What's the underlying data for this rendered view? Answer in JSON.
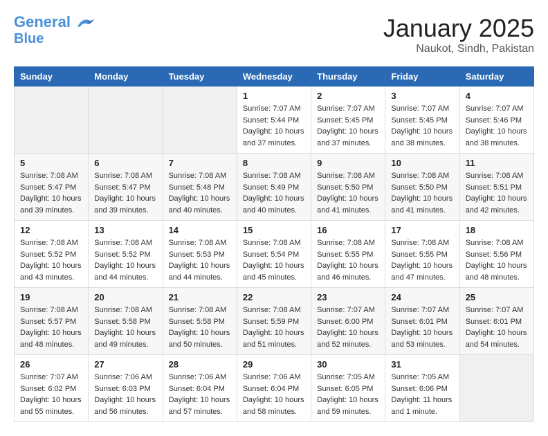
{
  "header": {
    "logo_line1": "General",
    "logo_line2": "Blue",
    "title": "January 2025",
    "subtitle": "Naukot, Sindh, Pakistan"
  },
  "weekdays": [
    "Sunday",
    "Monday",
    "Tuesday",
    "Wednesday",
    "Thursday",
    "Friday",
    "Saturday"
  ],
  "weeks": [
    [
      {
        "day": "",
        "info": ""
      },
      {
        "day": "",
        "info": ""
      },
      {
        "day": "",
        "info": ""
      },
      {
        "day": "1",
        "info": "Sunrise: 7:07 AM\nSunset: 5:44 PM\nDaylight: 10 hours\nand 37 minutes."
      },
      {
        "day": "2",
        "info": "Sunrise: 7:07 AM\nSunset: 5:45 PM\nDaylight: 10 hours\nand 37 minutes."
      },
      {
        "day": "3",
        "info": "Sunrise: 7:07 AM\nSunset: 5:45 PM\nDaylight: 10 hours\nand 38 minutes."
      },
      {
        "day": "4",
        "info": "Sunrise: 7:07 AM\nSunset: 5:46 PM\nDaylight: 10 hours\nand 38 minutes."
      }
    ],
    [
      {
        "day": "5",
        "info": "Sunrise: 7:08 AM\nSunset: 5:47 PM\nDaylight: 10 hours\nand 39 minutes."
      },
      {
        "day": "6",
        "info": "Sunrise: 7:08 AM\nSunset: 5:47 PM\nDaylight: 10 hours\nand 39 minutes."
      },
      {
        "day": "7",
        "info": "Sunrise: 7:08 AM\nSunset: 5:48 PM\nDaylight: 10 hours\nand 40 minutes."
      },
      {
        "day": "8",
        "info": "Sunrise: 7:08 AM\nSunset: 5:49 PM\nDaylight: 10 hours\nand 40 minutes."
      },
      {
        "day": "9",
        "info": "Sunrise: 7:08 AM\nSunset: 5:50 PM\nDaylight: 10 hours\nand 41 minutes."
      },
      {
        "day": "10",
        "info": "Sunrise: 7:08 AM\nSunset: 5:50 PM\nDaylight: 10 hours\nand 41 minutes."
      },
      {
        "day": "11",
        "info": "Sunrise: 7:08 AM\nSunset: 5:51 PM\nDaylight: 10 hours\nand 42 minutes."
      }
    ],
    [
      {
        "day": "12",
        "info": "Sunrise: 7:08 AM\nSunset: 5:52 PM\nDaylight: 10 hours\nand 43 minutes."
      },
      {
        "day": "13",
        "info": "Sunrise: 7:08 AM\nSunset: 5:52 PM\nDaylight: 10 hours\nand 44 minutes."
      },
      {
        "day": "14",
        "info": "Sunrise: 7:08 AM\nSunset: 5:53 PM\nDaylight: 10 hours\nand 44 minutes."
      },
      {
        "day": "15",
        "info": "Sunrise: 7:08 AM\nSunset: 5:54 PM\nDaylight: 10 hours\nand 45 minutes."
      },
      {
        "day": "16",
        "info": "Sunrise: 7:08 AM\nSunset: 5:55 PM\nDaylight: 10 hours\nand 46 minutes."
      },
      {
        "day": "17",
        "info": "Sunrise: 7:08 AM\nSunset: 5:55 PM\nDaylight: 10 hours\nand 47 minutes."
      },
      {
        "day": "18",
        "info": "Sunrise: 7:08 AM\nSunset: 5:56 PM\nDaylight: 10 hours\nand 48 minutes."
      }
    ],
    [
      {
        "day": "19",
        "info": "Sunrise: 7:08 AM\nSunset: 5:57 PM\nDaylight: 10 hours\nand 48 minutes."
      },
      {
        "day": "20",
        "info": "Sunrise: 7:08 AM\nSunset: 5:58 PM\nDaylight: 10 hours\nand 49 minutes."
      },
      {
        "day": "21",
        "info": "Sunrise: 7:08 AM\nSunset: 5:58 PM\nDaylight: 10 hours\nand 50 minutes."
      },
      {
        "day": "22",
        "info": "Sunrise: 7:08 AM\nSunset: 5:59 PM\nDaylight: 10 hours\nand 51 minutes."
      },
      {
        "day": "23",
        "info": "Sunrise: 7:07 AM\nSunset: 6:00 PM\nDaylight: 10 hours\nand 52 minutes."
      },
      {
        "day": "24",
        "info": "Sunrise: 7:07 AM\nSunset: 6:01 PM\nDaylight: 10 hours\nand 53 minutes."
      },
      {
        "day": "25",
        "info": "Sunrise: 7:07 AM\nSunset: 6:01 PM\nDaylight: 10 hours\nand 54 minutes."
      }
    ],
    [
      {
        "day": "26",
        "info": "Sunrise: 7:07 AM\nSunset: 6:02 PM\nDaylight: 10 hours\nand 55 minutes."
      },
      {
        "day": "27",
        "info": "Sunrise: 7:06 AM\nSunset: 6:03 PM\nDaylight: 10 hours\nand 56 minutes."
      },
      {
        "day": "28",
        "info": "Sunrise: 7:06 AM\nSunset: 6:04 PM\nDaylight: 10 hours\nand 57 minutes."
      },
      {
        "day": "29",
        "info": "Sunrise: 7:06 AM\nSunset: 6:04 PM\nDaylight: 10 hours\nand 58 minutes."
      },
      {
        "day": "30",
        "info": "Sunrise: 7:05 AM\nSunset: 6:05 PM\nDaylight: 10 hours\nand 59 minutes."
      },
      {
        "day": "31",
        "info": "Sunrise: 7:05 AM\nSunset: 6:06 PM\nDaylight: 11 hours\nand 1 minute."
      },
      {
        "day": "",
        "info": ""
      }
    ]
  ]
}
